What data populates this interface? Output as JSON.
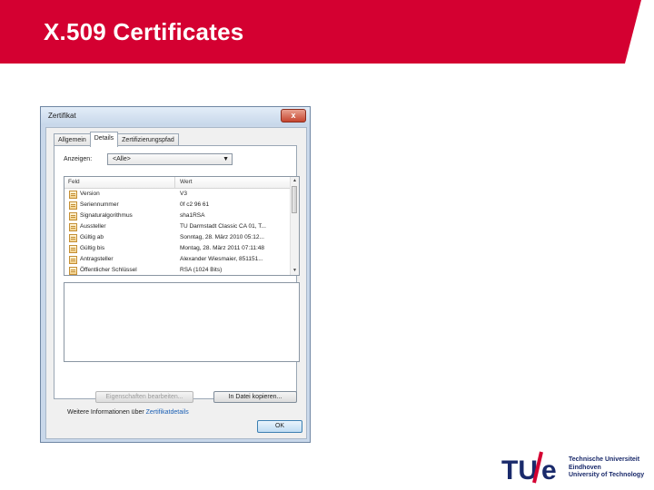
{
  "slide": {
    "title": "X.509 Certificates",
    "header_color": "#d40031"
  },
  "dialog": {
    "title": "Zertifikat",
    "close_glyph": "x",
    "tabs": [
      {
        "label": "Allgemein",
        "active": false
      },
      {
        "label": "Details",
        "active": true
      },
      {
        "label": "Zertifizierungspfad",
        "active": false
      }
    ],
    "show_label": "Anzeigen:",
    "show_select": "<Alle>",
    "columns": {
      "field": "Feld",
      "value": "Wert"
    },
    "rows": [
      {
        "field": "Version",
        "value": "V3"
      },
      {
        "field": "Seriennummer",
        "value": "0f c2 96 61"
      },
      {
        "field": "Signaturalgorithmus",
        "value": "sha1RSA"
      },
      {
        "field": "Aussteller",
        "value": "TU Darmstadt Classic CA 01, T..."
      },
      {
        "field": "Gültig ab",
        "value": "Sonntag, 28. März 2010 05:12..."
      },
      {
        "field": "Gültig bis",
        "value": "Montag, 28. März 2011 07:11:48"
      },
      {
        "field": "Antragsteller",
        "value": "Alexander Wiesmaier, 851151..."
      },
      {
        "field": "Öffentlicher Schlüssel",
        "value": "RSA (1024 Bits)"
      }
    ],
    "edit_button": "Eigenschaften bearbeiten...",
    "copy_button": "In Datei kopieren...",
    "more_info_prefix": "Weitere Informationen über",
    "more_info_link": "Zertifikatdetails",
    "ok_button": "OK"
  },
  "logo": {
    "mark": "TU/e",
    "line1": "Technische Universiteit",
    "line2": "Eindhoven",
    "line3": "University of Technology",
    "brand_blue": "#1a2a6b",
    "brand_red": "#d40031"
  }
}
